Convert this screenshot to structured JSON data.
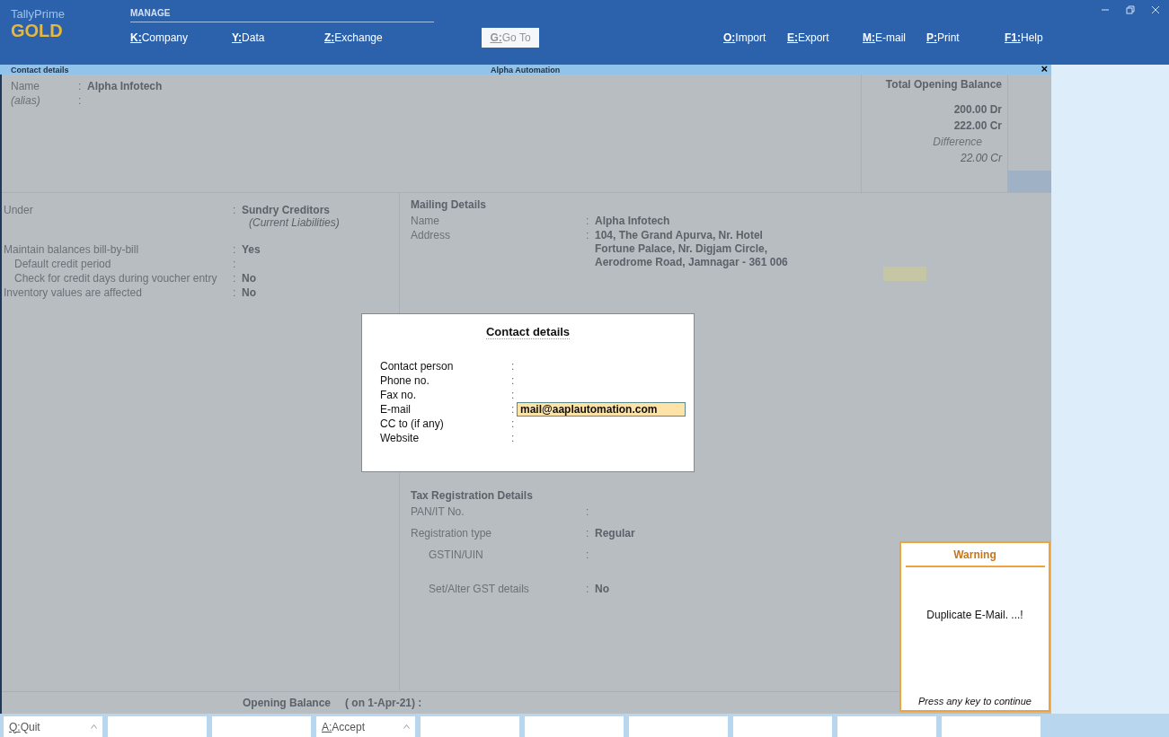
{
  "brand": {
    "product": "TallyPrime",
    "edition": "GOLD"
  },
  "menu": {
    "section": "MANAGE",
    "items": [
      {
        "key": "K:",
        "label": "Company",
        "disabled": false
      },
      {
        "key": "Y:",
        "label": "Data",
        "disabled": false
      },
      {
        "key": "Z:",
        "label": "Exchange",
        "disabled": false
      },
      {
        "key": "G:",
        "label": "Go To",
        "disabled": true
      },
      {
        "key": "O:",
        "label": "Import",
        "disabled": false
      },
      {
        "key": "E:",
        "label": "Export",
        "disabled": false
      },
      {
        "key": "M:",
        "label": "E-mail",
        "disabled": false
      },
      {
        "key": "P:",
        "label": "Print",
        "disabled": false
      },
      {
        "key": "F1:",
        "label": "Help",
        "disabled": false
      }
    ]
  },
  "window": {
    "title": "Contact details",
    "company": "Alpha Automation",
    "close": "×"
  },
  "ledger": {
    "name_label": "Name",
    "name_sep": ":",
    "name": "Alpha Infotech",
    "alias_label": "(alias)",
    "alias_sep": ":",
    "balance": {
      "title": "Total Opening Balance",
      "debit": "200.00 Dr",
      "credit": "222.00 Cr",
      "difference_label": "Difference",
      "difference": "22.00 Cr"
    },
    "left": [
      {
        "label": "Under",
        "sep": ":",
        "value": "Sundry Creditors",
        "sub": "(Current Liabilities)",
        "indent": false
      },
      {
        "label": "Maintain balances bill-by-bill",
        "sep": ":",
        "value": "Yes",
        "indent": false
      },
      {
        "label": "Default credit period",
        "sep": ":",
        "indent": true
      },
      {
        "label": "Check for credit days during voucher entry",
        "sep": ":",
        "value": "No",
        "indent": true
      },
      {
        "label": "Inventory values are affected",
        "sep": ":",
        "value": "No",
        "indent": false
      }
    ],
    "mailing": {
      "title": "Mailing Details",
      "name_label": "Name",
      "name_sep": ":",
      "name": "Alpha Infotech",
      "address_label": "Address",
      "address_sep": ":",
      "address": [
        "104, The Grand Apurva, Nr. Hotel",
        "Fortune Palace, Nr. Digjam Circle,",
        "Aerodrome Road, Jamnagar - 361 006"
      ]
    },
    "tax": {
      "title": "Tax Registration Details",
      "rows": [
        {
          "label": "PAN/IT No.",
          "sep": ":",
          "indent": false
        },
        {
          "label": "Registration type",
          "sep": ":",
          "value": "Regular",
          "indent": false
        },
        {
          "label": "GSTIN/UIN",
          "sep": ":",
          "indent": true
        },
        {
          "label": "Set/Alter GST details",
          "sep": ":",
          "value": "No",
          "indent": true
        }
      ]
    },
    "opening": {
      "label": "Opening Balance",
      "date": "( on 1-Apr-21)  :"
    }
  },
  "dialog": {
    "title": "Contact details",
    "fields": [
      {
        "label": "Contact person",
        "sep": ":",
        "selected": false
      },
      {
        "label": "Phone no.",
        "sep": ":",
        "selected": false
      },
      {
        "label": "Fax no.",
        "sep": ":",
        "selected": false
      },
      {
        "label": "E-mail",
        "sep": ":",
        "value": "mail@aaplautomation.com",
        "selected": true
      },
      {
        "label": "CC to (if any)",
        "sep": ":",
        "selected": false
      },
      {
        "label": "Website",
        "sep": ":",
        "selected": false
      }
    ]
  },
  "warning": {
    "title": "Warning",
    "message": "Duplicate E-Mail. ...!",
    "hint": "Press any key to continue"
  },
  "buttons": [
    {
      "key": "Q:",
      "label": "Quit",
      "caret": true
    },
    {
      "caret": false
    },
    {
      "caret": false
    },
    {
      "key": "A:",
      "label": "Accept",
      "caret": true
    },
    {
      "caret": false
    },
    {
      "caret": false
    },
    {
      "caret": false
    },
    {
      "caret": false
    },
    {
      "caret": false
    },
    {
      "caret": false
    }
  ]
}
